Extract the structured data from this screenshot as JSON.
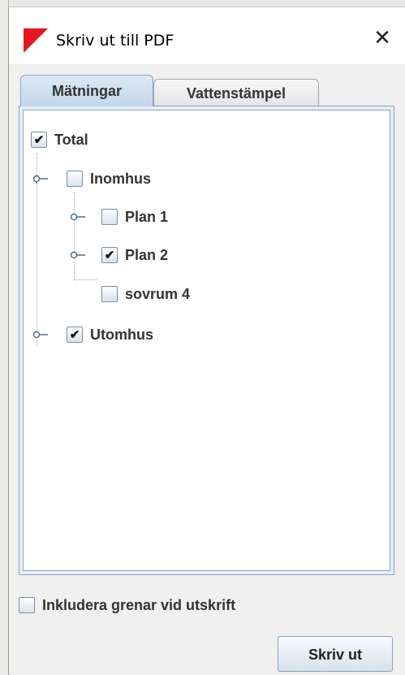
{
  "window": {
    "title": "Skriv ut till PDF",
    "close_glyph": "✕",
    "icon": "red-triangle-logo",
    "accent": "#e8141e"
  },
  "tabs": [
    {
      "label": "Mätningar",
      "active": true
    },
    {
      "label": "Vattenstämpel",
      "active": false
    }
  ],
  "tree": {
    "items": [
      {
        "label": "Total",
        "checked": true,
        "level": 0
      },
      {
        "label": "Inomhus",
        "checked": false,
        "level": 1,
        "expandable": true
      },
      {
        "label": "Plan 1",
        "checked": false,
        "level": 2,
        "expandable": true
      },
      {
        "label": "Plan 2",
        "checked": true,
        "level": 2,
        "expandable": true
      },
      {
        "label": "sovrum 4",
        "checked": false,
        "level": 2,
        "expandable": false
      },
      {
        "label": "Utomhus",
        "checked": true,
        "level": 1,
        "expandable": true
      }
    ]
  },
  "options": {
    "include_branches_label": "Inkludera grenar vid utskrift",
    "include_branches_checked": false
  },
  "actions": {
    "print_label": "Skriv ut"
  },
  "check_glyph": "✔"
}
